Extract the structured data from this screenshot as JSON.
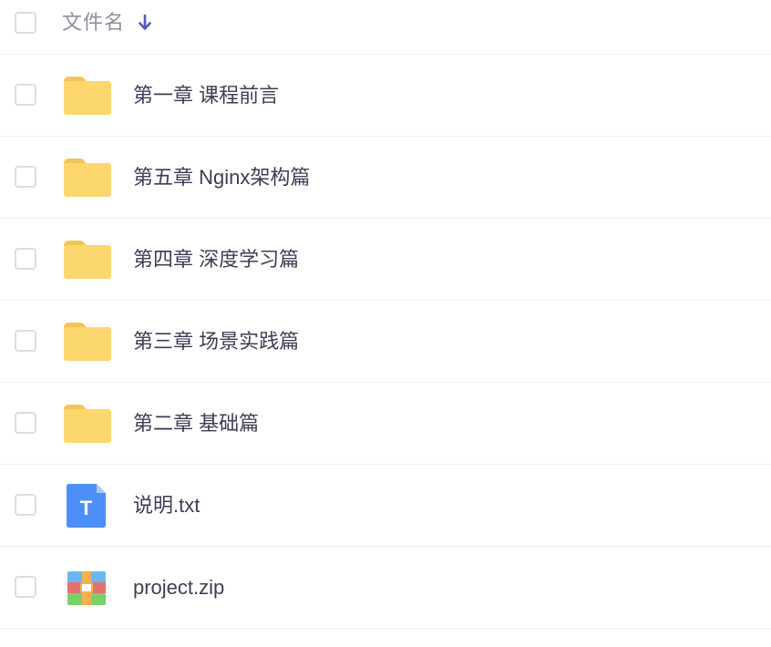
{
  "header": {
    "column_label": "文件名",
    "sort_icon": "arrow-down-icon",
    "sort_color": "#5b57b8"
  },
  "files": [
    {
      "name": "第一章 课程前言",
      "type": "folder",
      "icon": "folder-icon"
    },
    {
      "name": "第五章 Nginx架构篇",
      "type": "folder",
      "icon": "folder-icon"
    },
    {
      "name": "第四章 深度学习篇",
      "type": "folder",
      "icon": "folder-icon"
    },
    {
      "name": "第三章 场景实践篇",
      "type": "folder",
      "icon": "folder-icon"
    },
    {
      "name": "第二章 基础篇",
      "type": "folder",
      "icon": "folder-icon"
    },
    {
      "name": "说明.txt",
      "type": "txt",
      "icon": "text-file-icon",
      "glyph": "T"
    },
    {
      "name": "project.zip",
      "type": "zip",
      "icon": "archive-file-icon"
    }
  ],
  "colors": {
    "folder": "#fbd76e",
    "folder_tab": "#f2c558",
    "txt": "#4e8ff7",
    "text": "#3c3e55",
    "header_text": "#8e8f9c"
  }
}
